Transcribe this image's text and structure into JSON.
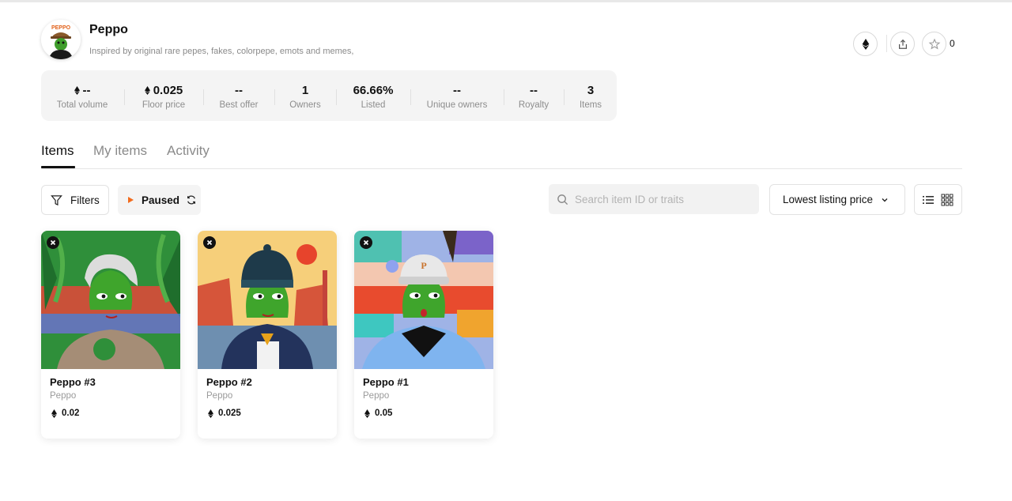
{
  "collection": {
    "name": "Peppo",
    "avatar_text": "PEPPO",
    "description": "Inspired by original rare pepes, fakes, colorpepe, emots and memes,",
    "favorite_count": "0"
  },
  "header_icons": [
    "ethereum-icon",
    "share-icon",
    "star-icon"
  ],
  "stats": [
    {
      "value": "--",
      "label": "Total volume",
      "eth": true
    },
    {
      "value": "0.025",
      "label": "Floor price",
      "eth": true
    },
    {
      "value": "--",
      "label": "Best offer",
      "eth": false
    },
    {
      "value": "1",
      "label": "Owners",
      "eth": false
    },
    {
      "value": "66.66%",
      "label": "Listed",
      "eth": false
    },
    {
      "value": "--",
      "label": "Unique owners",
      "eth": false
    },
    {
      "value": "--",
      "label": "Royalty",
      "eth": false
    },
    {
      "value": "3",
      "label": "Items",
      "eth": false
    }
  ],
  "tabs": [
    "Items",
    "My items",
    "Activity"
  ],
  "active_tab": "Items",
  "toolbar": {
    "filters_label": "Filters",
    "paused_label": "Paused",
    "search_placeholder": "Search item ID or traits",
    "sort_label": "Lowest listing price"
  },
  "items": [
    {
      "name": "Peppo #3",
      "collection": "Peppo",
      "price": "0.02"
    },
    {
      "name": "Peppo #2",
      "collection": "Peppo",
      "price": "0.025"
    },
    {
      "name": "Peppo #1",
      "collection": "Peppo",
      "price": "0.05"
    }
  ],
  "colors": {
    "accent_orange": "#f26b1d",
    "stat_bg": "#f4f4f4",
    "pepe_green": "#3f9e2c"
  }
}
